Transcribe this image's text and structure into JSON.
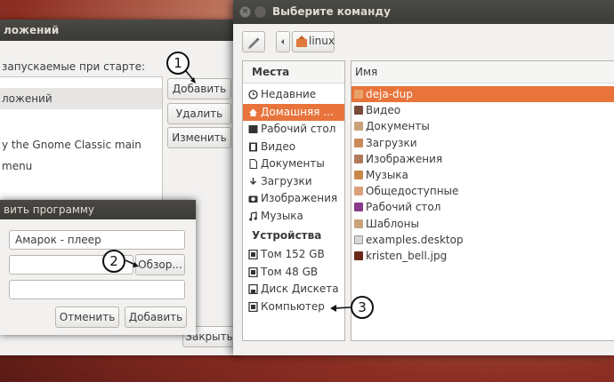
{
  "startup": {
    "title_fragment": "ложений",
    "label": "запускаемые при старте:",
    "list": [
      "ложений",
      "y the Gnome Classic main menu"
    ],
    "buttons": {
      "add": "Добавить",
      "remove": "Удалить",
      "edit": "Изменить",
      "close": "Закрыть"
    }
  },
  "dialog": {
    "title_fragment": "вить программу",
    "name_value": "Амарок - плеер",
    "browse": "Обзор...",
    "cancel": "Отменить",
    "add": "Добавить"
  },
  "chooser": {
    "title": "Выберите команду",
    "path_button": "linux",
    "places_header": "Места",
    "places": [
      {
        "label": "Недавние",
        "icon": "clock-icon"
      },
      {
        "label": "Домашняя ...",
        "icon": "home-icon",
        "selected": true
      },
      {
        "label": "Рабочий стол",
        "icon": "desktop-icon"
      },
      {
        "label": "Видео",
        "icon": "film-icon"
      },
      {
        "label": "Документы",
        "icon": "document-icon"
      },
      {
        "label": "Загрузки",
        "icon": "download-icon"
      },
      {
        "label": "Изображения",
        "icon": "camera-icon"
      },
      {
        "label": "Музыка",
        "icon": "music-icon"
      }
    ],
    "devices_header": "Устройства",
    "devices": [
      {
        "label": "Том 152 GB",
        "icon": "drive-icon"
      },
      {
        "label": "Том 48 GB",
        "icon": "drive-icon"
      },
      {
        "label": "Диск Дискета",
        "icon": "floppy-icon"
      },
      {
        "label": "Компьютер",
        "icon": "computer-icon"
      }
    ],
    "files_header": "Имя",
    "files": [
      {
        "name": "deja-dup",
        "selected": true,
        "color": "#e8a36b"
      },
      {
        "name": "Видео",
        "color": "#7a4a3a"
      },
      {
        "name": "Документы",
        "color": "#c9a27a"
      },
      {
        "name": "Загрузки",
        "color": "#c98a5a"
      },
      {
        "name": "Изображения",
        "color": "#b07a5a"
      },
      {
        "name": "Музыка",
        "color": "#c9884a"
      },
      {
        "name": "Общедоступные",
        "color": "#d9a07a"
      },
      {
        "name": "Рабочий стол",
        "color": "#8a3a8a"
      },
      {
        "name": "Шаблоны",
        "color": "#c9a27a"
      },
      {
        "name": "examples.desktop",
        "color": "#d8d8d8"
      },
      {
        "name": "kristen_bell.jpg",
        "color": "#6a2a1a"
      }
    ]
  },
  "callouts": [
    "1",
    "2",
    "3"
  ],
  "colors": {
    "accent": "#e8743b",
    "titlebar": "#3c3b37"
  }
}
